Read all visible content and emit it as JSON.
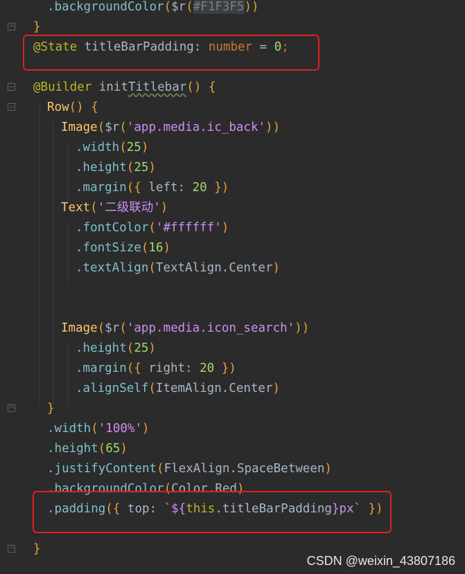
{
  "editor": {
    "lines": [
      {
        "id": "l1",
        "segments": [
          ".backgroundColor",
          "(",
          "$r",
          "(",
          "#F1F3F5",
          "))"
        ]
      },
      {
        "id": "l2",
        "segments": [
          "}"
        ]
      },
      {
        "id": "l3",
        "segments": [
          "@State",
          " titleBarPadding",
          ": ",
          "number",
          " = ",
          "0",
          ";"
        ]
      },
      {
        "id": "l4",
        "segments": [
          ""
        ]
      },
      {
        "id": "l5",
        "segments": [
          "@Builder",
          " init",
          "Titlebar",
          "() {"
        ]
      },
      {
        "id": "l6",
        "segments": [
          "Row",
          "() {"
        ]
      },
      {
        "id": "l7",
        "segments": [
          "Image",
          "(",
          "$r",
          "(",
          "'app.media.ic_back'",
          "))"
        ]
      },
      {
        "id": "l8",
        "segments": [
          ".width",
          "(",
          "25",
          ")"
        ]
      },
      {
        "id": "l9",
        "segments": [
          ".height",
          "(",
          "25",
          ")"
        ]
      },
      {
        "id": "l10",
        "segments": [
          ".margin",
          "({ ",
          "left",
          ": ",
          "20",
          " })"
        ]
      },
      {
        "id": "l11",
        "segments": [
          "Text",
          "(",
          "'二级联动'",
          ")"
        ]
      },
      {
        "id": "l12",
        "segments": [
          ".fontColor",
          "(",
          "'#ffffff'",
          ")"
        ]
      },
      {
        "id": "l13",
        "segments": [
          ".fontSize",
          "(",
          "16",
          ")"
        ]
      },
      {
        "id": "l14",
        "segments": [
          ".textAlign",
          "(",
          "TextAlign",
          ".",
          "Center",
          ")"
        ]
      },
      {
        "id": "l15",
        "segments": [
          ""
        ]
      },
      {
        "id": "l16",
        "segments": [
          ""
        ]
      },
      {
        "id": "l17",
        "segments": [
          "Image",
          "(",
          "$r",
          "(",
          "'app.media.icon_search'",
          "))"
        ]
      },
      {
        "id": "l18",
        "segments": [
          ".height",
          "(",
          "25",
          ")"
        ]
      },
      {
        "id": "l19",
        "segments": [
          ".margin",
          "({ ",
          "right",
          ": ",
          "20",
          " })"
        ]
      },
      {
        "id": "l20",
        "segments": [
          ".alignSelf",
          "(",
          "ItemAlign",
          ".",
          "Center",
          ")"
        ]
      },
      {
        "id": "l21",
        "segments": [
          "}"
        ]
      },
      {
        "id": "l22",
        "segments": [
          ".width",
          "(",
          "'100%'",
          ")"
        ]
      },
      {
        "id": "l23",
        "segments": [
          ".height",
          "(",
          "65",
          ")"
        ]
      },
      {
        "id": "l24",
        "segments": [
          ".justifyContent",
          "(",
          "FlexAlign",
          ".",
          "SpaceBetween",
          ")"
        ]
      },
      {
        "id": "l25",
        "segments": [
          ".backgroundColor",
          "(",
          "Color",
          ".",
          "Red",
          ")"
        ]
      },
      {
        "id": "l26",
        "segments": [
          ".padding",
          "({ ",
          "top",
          ": ",
          "`${",
          "this",
          ".titleBarPadding",
          "}px`",
          " })"
        ]
      },
      {
        "id": "l27",
        "segments": [
          ""
        ]
      },
      {
        "id": "l28",
        "segments": [
          "}"
        ]
      }
    ]
  },
  "watermark": "CSDN @weixin_43807186",
  "colors": {
    "background": "#2b2b2b",
    "highlight_box": "#e02020"
  }
}
